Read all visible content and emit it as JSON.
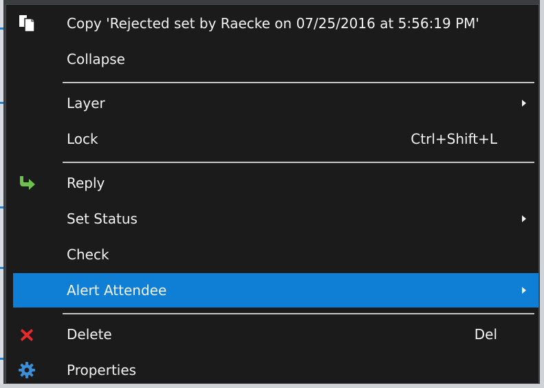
{
  "menu": {
    "items": [
      {
        "label": "Copy 'Rejected set by Raecke on 07/25/2016 at 5:56:19 PM'",
        "icon": "copy-icon"
      },
      {
        "label": "Collapse"
      },
      {
        "label": "Layer",
        "submenu": true
      },
      {
        "label": "Lock",
        "shortcut": "Ctrl+Shift+L"
      },
      {
        "label": "Reply",
        "icon": "reply-arrow-icon"
      },
      {
        "label": "Set Status",
        "submenu": true
      },
      {
        "label": "Check"
      },
      {
        "label": "Alert Attendee",
        "submenu": true,
        "highlighted": true
      },
      {
        "label": "Delete",
        "shortcut": "Del",
        "icon": "delete-x-icon"
      },
      {
        "label": "Properties",
        "icon": "gear-icon"
      }
    ]
  },
  "colors": {
    "menu_background": "#1b1b1b",
    "highlight": "#0f7fd6",
    "text": "#f2f2f2",
    "separator": "#c9c9c9",
    "reply_icon": "#6cc24a",
    "delete_icon": "#e52b2b",
    "gear_icon": "#3a8fd8"
  }
}
